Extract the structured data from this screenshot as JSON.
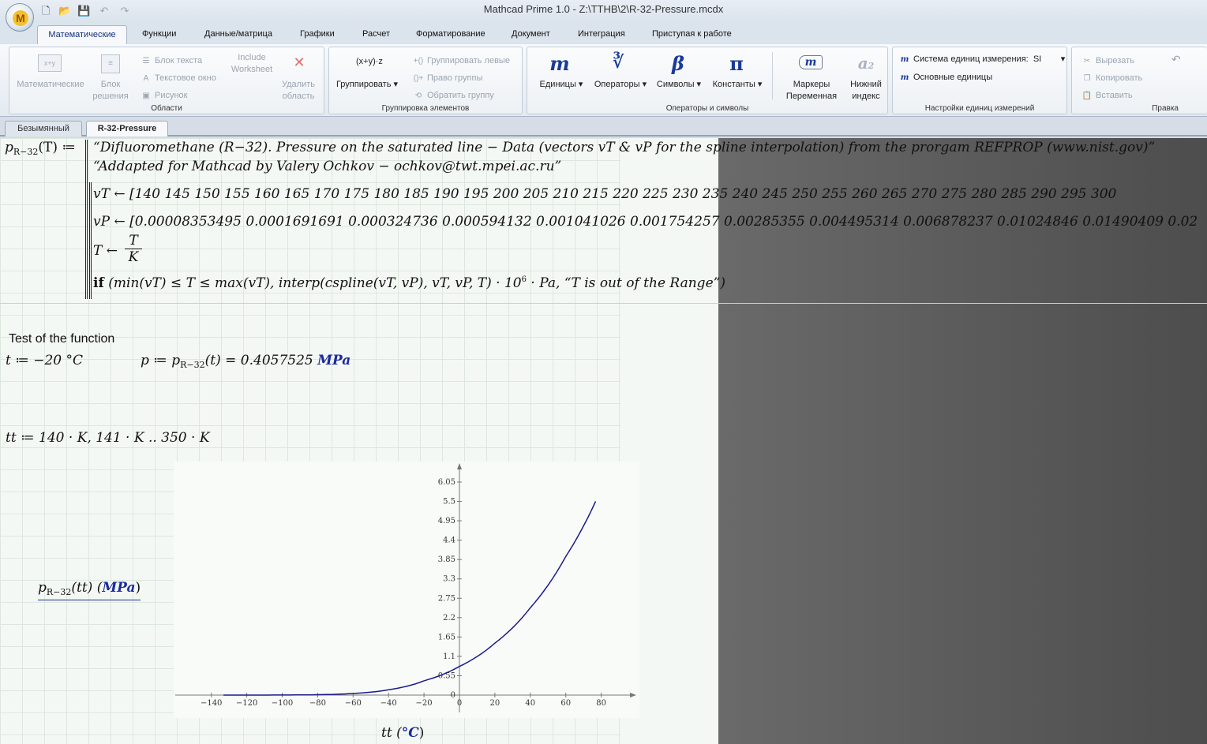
{
  "window": {
    "title": "Mathcad Prime 1.0 - Z:\\TTHB\\2\\R-32-Pressure.mcdx"
  },
  "ribbon_tabs": [
    "Математические",
    "Функции",
    "Данные/матрица",
    "Графики",
    "Расчет",
    "Форматирование",
    "Документ",
    "Интеграция",
    "Приступая к работе"
  ],
  "ribbon": {
    "regions": {
      "caption": "Области",
      "math": "Математические",
      "block": "Блок\nрешения",
      "text_block": "Блок текста",
      "text_box": "Текстовое окно",
      "picture": "Рисунок",
      "include": "Include\nWorksheet",
      "delete": "Удалить\nобласть"
    },
    "grouping": {
      "caption": "Группировка элементов",
      "group": "Группировать",
      "group_left": "Группировать левые",
      "group_right": "Право группы",
      "ungroup": "Обратить группу"
    },
    "operators": {
      "caption": "Операторы и символы",
      "units": "Единицы",
      "operators": "Операторы",
      "symbols": "Символы",
      "constants": "Константы",
      "markers": "Маркеры\nПеременная",
      "subscript": "Нижний\nиндекс"
    },
    "units_settings": {
      "caption": "Настройки единиц измерений",
      "system": "Система единиц измерения:",
      "system_value": "SI",
      "base_units": "Основные единицы"
    },
    "edit": {
      "caption": "Правка",
      "cut": "Вырезать",
      "copy": "Копировать",
      "paste": "Вставить"
    }
  },
  "doc_tabs": [
    "Безымянный",
    "R-32-Pressure"
  ],
  "worksheet": {
    "func_def": "p",
    "func_sub": "R−32",
    "func_arg": "(T) ≔",
    "comment1": "“Difluoromethane (R−32). Pressure on the saturated line − Data (vectors vT & vP for the spline interpolation) from the prorgam REFPROP (www.nist.gov)”",
    "comment2": "“Addapted for Mathcad by Valery Ochkov − ochkov@twt.mpei.ac.ru”",
    "vT_line": "vT ← [140  145  150  155  160  165  170  175  180  185  190  195  200  205  210  215  220  225  230  235  240  245  250  255  260  265  270  275  280  285  290  295  300",
    "vP_line": "vP ← [0.00008353495  0.0001691691  0.000324736  0.000594132  0.001041026  0.001754257  0.00285355  0.004495314  0.006878237  0.01024846  0.01490409  0.02",
    "T_line": "T ←",
    "T_num": "T",
    "T_den": "K",
    "if_kw": "if",
    "if_line": "(min(vT) ≤ T ≤ max(vT), interp(cspline(vT, vP), vT, vP, T) · 10",
    "if_exp": "6",
    "if_tail": "· Pa, “T is out of the Range”)",
    "test_title": "Test of the function",
    "t_def": "t ≔ −20 °C",
    "p_def_a": "p ≔ p",
    "p_def_sub": "R−32",
    "p_def_b": "(t) = 0.4057525",
    "p_def_unit": "MPa",
    "tt_def": "tt ≔ 140 · K, 141 · K .. 350 · K",
    "yaxis_a": "p",
    "yaxis_sub": "R−32",
    "yaxis_b": "(tt)  (",
    "yaxis_unit": "MPa",
    "yaxis_c": ")",
    "xaxis_a": "tt  (",
    "xaxis_unit": "°C",
    "xaxis_c": ")"
  },
  "chart_data": {
    "type": "line",
    "xlabel": "tt (°C)",
    "ylabel": "pR−32(tt) (MPa)",
    "xlim": [
      -150,
      100
    ],
    "ylim": [
      0,
      6.3
    ],
    "xticks": [
      -140,
      -120,
      -100,
      -80,
      -60,
      -40,
      -20,
      0,
      20,
      40,
      60,
      80
    ],
    "yticks": [
      0,
      0.55,
      1.1,
      1.65,
      2.2,
      2.75,
      3.3,
      3.85,
      4.4,
      4.95,
      5.5,
      6.05
    ],
    "series": [
      {
        "name": "",
        "color": "#1a1a8a",
        "x": [
          -133.15,
          -120,
          -100,
          -80,
          -60,
          -40,
          -20,
          0,
          20,
          40,
          60,
          76.85
        ],
        "y": [
          8e-05,
          0.0003,
          0.0021,
          0.0104,
          0.0457,
          0.1507,
          0.4058,
          0.813,
          1.4741,
          2.4784,
          3.9338,
          5.5
        ]
      }
    ]
  }
}
